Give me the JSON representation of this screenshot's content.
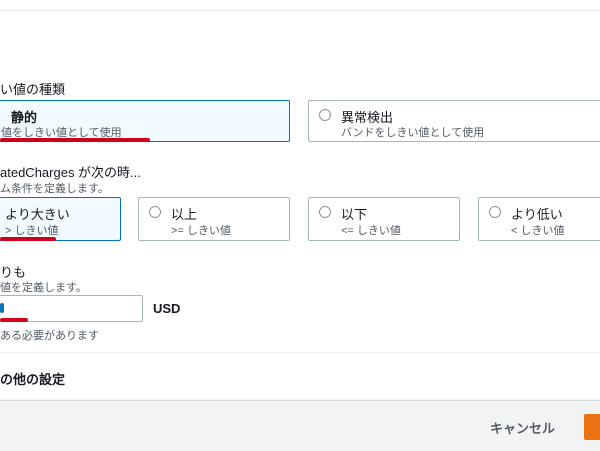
{
  "header": {
    "partial_char": "t"
  },
  "threshold_type": {
    "label": "い値の種類",
    "options": [
      {
        "title": "静的",
        "desc": "値をしきい値として使用",
        "selected": true
      },
      {
        "title": "異常検出",
        "desc": "バンドをしきい値として使用",
        "selected": false
      }
    ]
  },
  "condition": {
    "label": "atedCharges が次の時...",
    "desc": "ム条件を定義します。",
    "options": [
      {
        "title": "より大きい",
        "desc": "> しきい値",
        "selected": true
      },
      {
        "title": "以上",
        "desc": ">= しきい値",
        "selected": false
      },
      {
        "title": "以下",
        "desc": "<= しきい値",
        "selected": false
      },
      {
        "title": "より低い",
        "desc": "< しきい値",
        "selected": false
      }
    ]
  },
  "threshold_value": {
    "label": "りも",
    "desc": "値を定義します。",
    "input_value": "",
    "unit": "USD",
    "hint": "ある必要があります"
  },
  "other_settings": {
    "label": "の他の設定"
  },
  "footer": {
    "cancel_label": "キャンセル"
  },
  "colors": {
    "accent": "#0073bb",
    "primary_button": "#ec7211",
    "annotation_red": "#d0021b"
  }
}
